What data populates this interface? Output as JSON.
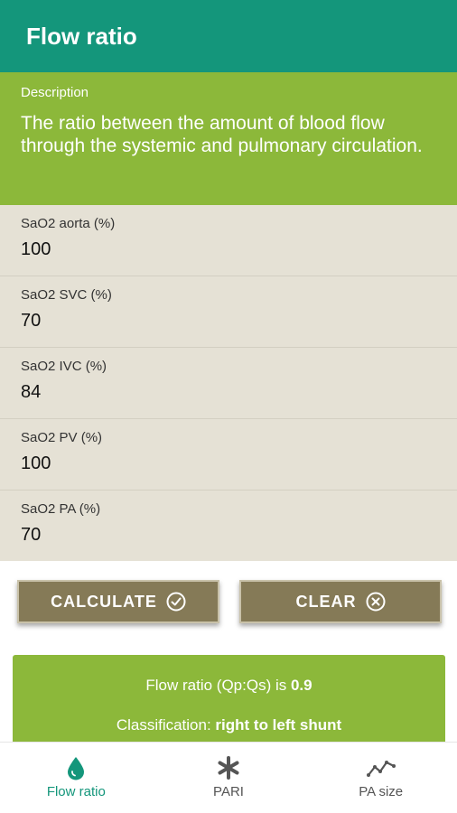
{
  "app_bar": {
    "title": "Flow ratio"
  },
  "description": {
    "heading": "Description",
    "text": "The ratio between the amount of blood flow through the systemic and pulmonary circulation."
  },
  "fields": [
    {
      "label": "SaO2 aorta (%)",
      "value": "100"
    },
    {
      "label": "SaO2 SVC (%)",
      "value": "70"
    },
    {
      "label": "SaO2 IVC (%)",
      "value": "84"
    },
    {
      "label": "SaO2 PV (%)",
      "value": "100"
    },
    {
      "label": "SaO2 PA (%)",
      "value": "70"
    }
  ],
  "buttons": {
    "calculate": {
      "label": "CALCULATE",
      "icon": "check-circle-icon"
    },
    "clear": {
      "label": "CLEAR",
      "icon": "x-circle-icon"
    }
  },
  "result": {
    "ratio_prefix": "Flow ratio (Qp:Qs) is ",
    "ratio_value": "0.9",
    "class_prefix": "Classification: ",
    "class_value": "right to left shunt"
  },
  "nav": [
    {
      "label": "Flow ratio",
      "icon": "drop-icon",
      "active": true
    },
    {
      "label": "PARI",
      "icon": "asterisk-icon",
      "active": false
    },
    {
      "label": "PA size",
      "icon": "line-chart-icon",
      "active": false
    }
  ],
  "colors": {
    "primary": "#14967b",
    "accent": "#8cb83a",
    "button": "#857a57",
    "field_bg": "#e5e1d5"
  }
}
